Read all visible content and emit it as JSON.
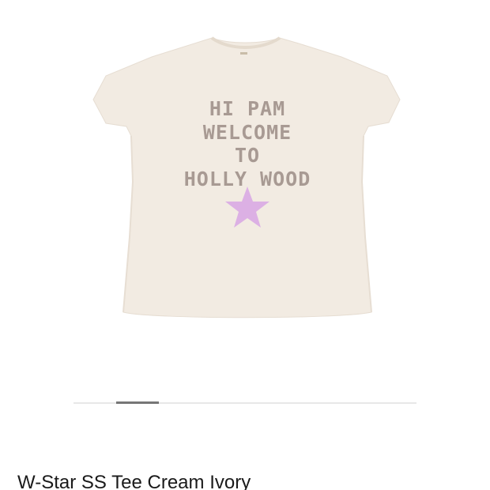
{
  "product": {
    "title": "W-Star SS Tee Cream Ivory",
    "image": {
      "garment_color": "#f2ebe2",
      "print_color": "#a89a93",
      "star_color": "#dcb0e4",
      "print_lines": [
        "HI PAM",
        "WELCOME",
        "TO",
        "HOLLY WOOD"
      ],
      "star_icon": "star-icon"
    }
  },
  "carousel": {
    "track_color": "#e8e8e8",
    "indicator_color": "#767676"
  }
}
